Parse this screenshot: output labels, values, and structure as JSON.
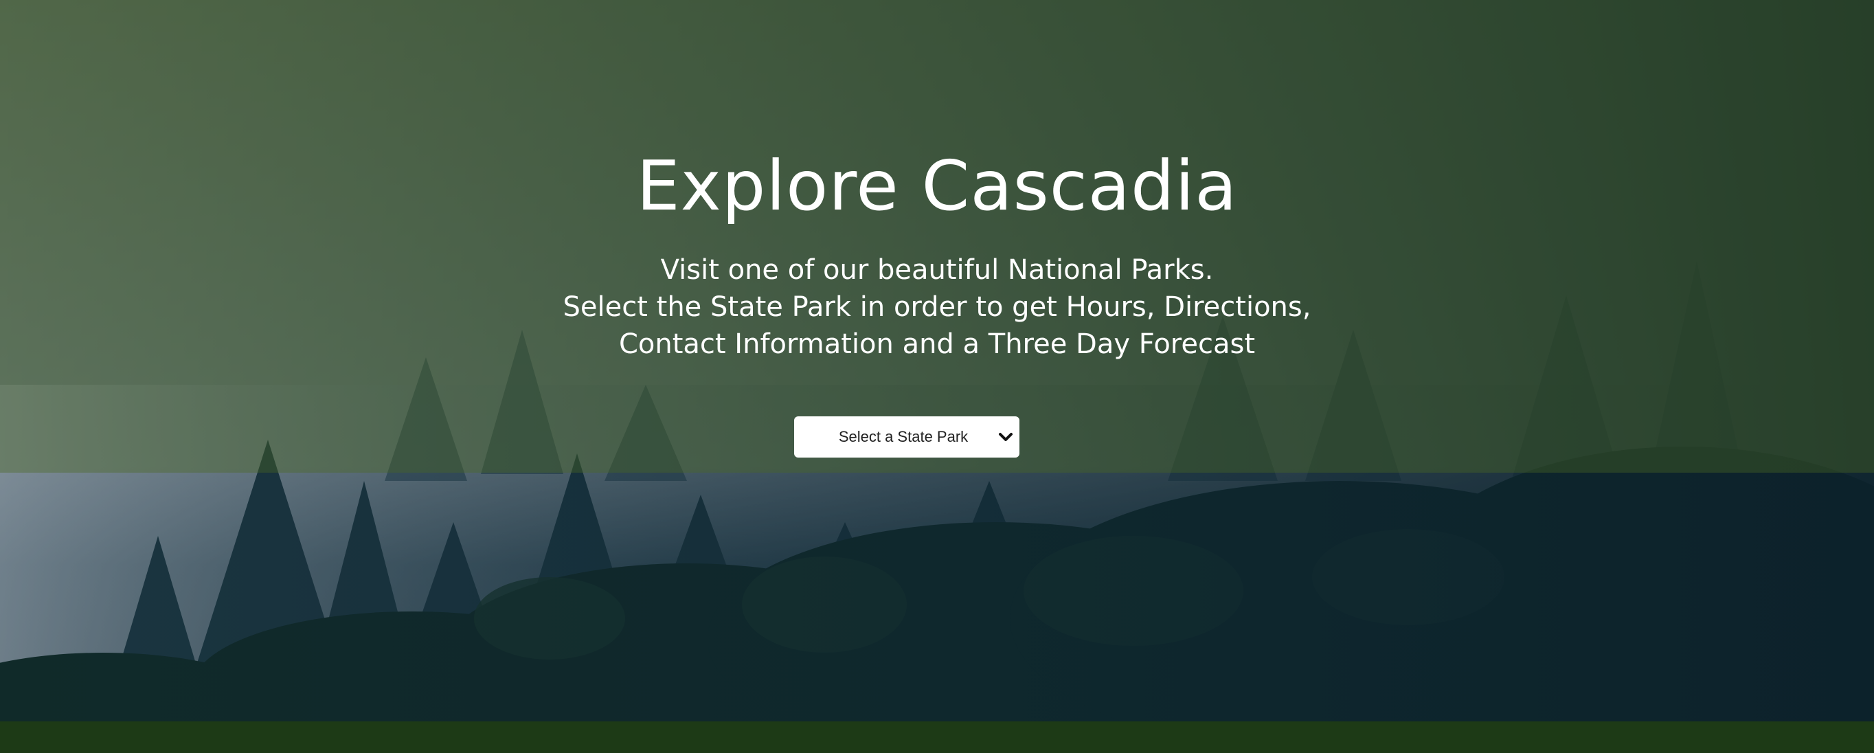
{
  "hero": {
    "title": "Explore Cascadia",
    "subtitle_lines": [
      "Visit one of our beautiful National Parks.",
      "Select the State Park in order to get Hours, Directions,",
      "Contact Information and a Three Day Forecast"
    ]
  },
  "park_select": {
    "selected": "Select a State Park",
    "icon": "chevron-down-icon"
  },
  "colors": {
    "hero_overlay": "#3a5626",
    "sky_mist": "#7c8e9a",
    "forest_dark": "#0f2a36",
    "footer_bar": "#1d3a16",
    "text": "#ffffff"
  }
}
